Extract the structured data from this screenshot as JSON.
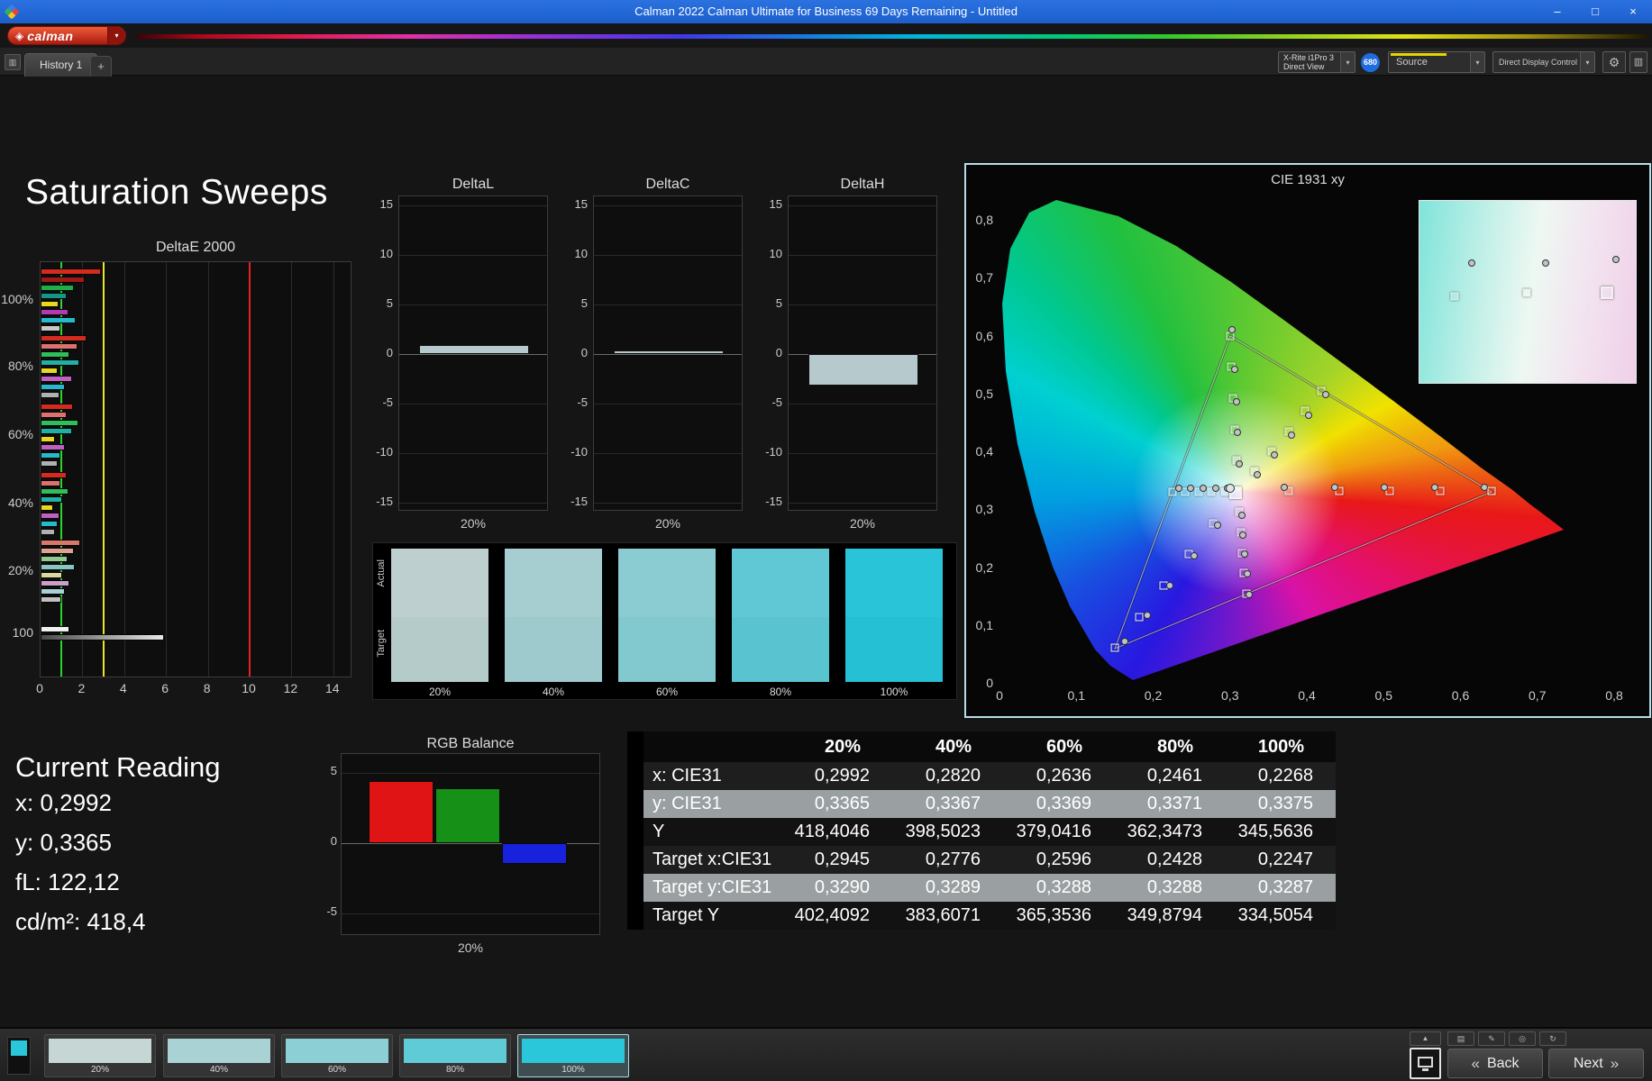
{
  "window": {
    "title": "Calman 2022 Calman Ultimate for Business 69 Days Remaining  - Untitled",
    "minimize": "–",
    "maximize": "□",
    "close": "×"
  },
  "brand": {
    "logo": "calman"
  },
  "tabbar": {
    "history_tab": "History 1",
    "add_tab": "+"
  },
  "toolbar": {
    "meter_line1": "X-Rite i1Pro 3",
    "meter_line2": "Direct View",
    "badge": "680",
    "source": "Source",
    "display_control": "Direct Display Control"
  },
  "icons": {
    "dropdown": "▾",
    "gear": "⚙",
    "menu": "▥",
    "layout": "▥",
    "collapse": "▲",
    "print": "▤",
    "annotate": "✎",
    "preview": "◎",
    "refresh": "↻",
    "back": "«",
    "next": "»",
    "diamond": "◈"
  },
  "page_title": "Saturation Sweeps",
  "deltaE": {
    "title": "DeltaE 2000",
    "x_ticks": [
      "0",
      "2",
      "4",
      "6",
      "8",
      "10",
      "12",
      "14"
    ],
    "ref": {
      "green": 1,
      "yellow": 3,
      "red": 10
    },
    "groups": [
      {
        "label": "100%",
        "bars": [
          {
            "color": "#d42a20",
            "value": 2.9
          },
          {
            "color": "#a01818",
            "value": 2.1
          },
          {
            "color": "#1fae4a",
            "value": 1.6
          },
          {
            "color": "#15958a",
            "value": 1.25
          },
          {
            "color": "#e8d820",
            "value": 0.85
          },
          {
            "color": "#b43ab4",
            "value": 1.35
          },
          {
            "color": "#28b8cc",
            "value": 1.7
          },
          {
            "color": "#c8c8c8",
            "value": 0.95
          }
        ]
      },
      {
        "label": "80%",
        "bars": [
          {
            "color": "#d42a20",
            "value": 2.2
          },
          {
            "color": "#e07070",
            "value": 1.75
          },
          {
            "color": "#2fbe5a",
            "value": 1.4
          },
          {
            "color": "#20b0a4",
            "value": 1.85
          },
          {
            "color": "#e8d820",
            "value": 0.8
          },
          {
            "color": "#c060c0",
            "value": 1.5
          },
          {
            "color": "#28b8cc",
            "value": 1.15
          },
          {
            "color": "#b0b0b0",
            "value": 0.9
          }
        ]
      },
      {
        "label": "60%",
        "bars": [
          {
            "color": "#d42a20",
            "value": 1.55
          },
          {
            "color": "#e07070",
            "value": 1.25
          },
          {
            "color": "#2fbe5a",
            "value": 1.8
          },
          {
            "color": "#20b0a4",
            "value": 1.5
          },
          {
            "color": "#e8d820",
            "value": 0.7
          },
          {
            "color": "#c060c0",
            "value": 1.15
          },
          {
            "color": "#28b8cc",
            "value": 0.95
          },
          {
            "color": "#b0b0b0",
            "value": 0.8
          }
        ]
      },
      {
        "label": "40%",
        "bars": [
          {
            "color": "#d42a20",
            "value": 1.25
          },
          {
            "color": "#e07070",
            "value": 0.95
          },
          {
            "color": "#2fbe5a",
            "value": 1.35
          },
          {
            "color": "#20b0a4",
            "value": 1.05
          },
          {
            "color": "#e8d820",
            "value": 0.6
          },
          {
            "color": "#c060c0",
            "value": 0.9
          },
          {
            "color": "#28b8cc",
            "value": 0.8
          },
          {
            "color": "#b0b0b0",
            "value": 0.7
          }
        ]
      },
      {
        "label": "20%",
        "bars": [
          {
            "color": "#d8786a",
            "value": 1.9
          },
          {
            "color": "#e0a090",
            "value": 1.6
          },
          {
            "color": "#90c890",
            "value": 1.3
          },
          {
            "color": "#88c4c4",
            "value": 1.65
          },
          {
            "color": "#d8d8a0",
            "value": 1.05
          },
          {
            "color": "#c8a0c8",
            "value": 1.4
          },
          {
            "color": "#a8d0d8",
            "value": 1.15
          },
          {
            "color": "#c0c0c0",
            "value": 1.0
          }
        ]
      },
      {
        "label": "100",
        "bars": [
          {
            "color": "#f0f0f0",
            "value": 1.4
          },
          {
            "color": "#bbbbbb",
            "value": 5.9,
            "gradient": true
          }
        ]
      }
    ]
  },
  "deltaL": {
    "title": "DeltaL",
    "x_label": "20%",
    "y_ticks": [
      "15",
      "10",
      "5",
      "0",
      "-5",
      "-10",
      "-15"
    ],
    "value": 0.9
  },
  "deltaC": {
    "title": "DeltaC",
    "x_label": "20%",
    "y_ticks": [
      "15",
      "10",
      "5",
      "0",
      "-5",
      "-10",
      "-15"
    ],
    "value": 0.4
  },
  "deltaH": {
    "title": "DeltaH",
    "x_label": "20%",
    "y_ticks": [
      "15",
      "10",
      "5",
      "0",
      "-5",
      "-10",
      "-15"
    ],
    "value": -3.2
  },
  "swatches": {
    "actual_label": "Actual",
    "target_label": "Target",
    "columns": [
      {
        "label": "20%",
        "actual": "#bdcfce",
        "target": "#b5cbca"
      },
      {
        "label": "40%",
        "actual": "#a6cdd0",
        "target": "#9ec9cd"
      },
      {
        "label": "60%",
        "actual": "#8accd2",
        "target": "#82c8cf"
      },
      {
        "label": "80%",
        "actual": "#60c8d4",
        "target": "#59c4d0"
      },
      {
        "label": "100%",
        "actual": "#2ac4d8",
        "target": "#25c0d4"
      }
    ]
  },
  "cie": {
    "title": "CIE 1931 xy",
    "x_ticks": [
      "0",
      "0,1",
      "0,2",
      "0,3",
      "0,4",
      "0,5",
      "0,6",
      "0,7",
      "0,8"
    ],
    "y_ticks": [
      "0,8",
      "0,7",
      "0,6",
      "0,5",
      "0,4",
      "0,3",
      "0,2",
      "0,1",
      "0"
    ],
    "squares": [
      [
        0.376,
        0.331
      ],
      [
        0.442,
        0.331
      ],
      [
        0.508,
        0.331
      ],
      [
        0.574,
        0.331
      ],
      [
        0.64,
        0.331
      ],
      [
        0.308,
        0.384
      ],
      [
        0.306,
        0.438
      ],
      [
        0.304,
        0.492
      ],
      [
        0.302,
        0.546
      ],
      [
        0.3,
        0.6
      ],
      [
        0.278,
        0.276
      ],
      [
        0.246,
        0.222
      ],
      [
        0.214,
        0.168
      ],
      [
        0.182,
        0.114
      ],
      [
        0.15,
        0.06
      ],
      [
        0.293,
        0.33
      ],
      [
        0.276,
        0.33
      ],
      [
        0.259,
        0.33
      ],
      [
        0.242,
        0.33
      ],
      [
        0.225,
        0.33
      ],
      [
        0.312,
        0.295
      ],
      [
        0.314,
        0.26
      ],
      [
        0.316,
        0.224
      ],
      [
        0.318,
        0.19
      ],
      [
        0.321,
        0.154
      ],
      [
        0.332,
        0.365
      ],
      [
        0.354,
        0.4
      ],
      [
        0.376,
        0.435
      ],
      [
        0.398,
        0.47
      ],
      [
        0.419,
        0.505
      ]
    ],
    "circles": [
      [
        0.371,
        0.337
      ],
      [
        0.436,
        0.337
      ],
      [
        0.501,
        0.338
      ],
      [
        0.566,
        0.338
      ],
      [
        0.631,
        0.338
      ],
      [
        0.312,
        0.378
      ],
      [
        0.31,
        0.432
      ],
      [
        0.308,
        0.486
      ],
      [
        0.306,
        0.542
      ],
      [
        0.303,
        0.61
      ],
      [
        0.284,
        0.272
      ],
      [
        0.253,
        0.22
      ],
      [
        0.222,
        0.168
      ],
      [
        0.192,
        0.116
      ],
      [
        0.163,
        0.072
      ],
      [
        0.297,
        0.336
      ],
      [
        0.281,
        0.336
      ],
      [
        0.265,
        0.336
      ],
      [
        0.249,
        0.336
      ],
      [
        0.233,
        0.336
      ],
      [
        0.315,
        0.29
      ],
      [
        0.317,
        0.256
      ],
      [
        0.319,
        0.222
      ],
      [
        0.322,
        0.188
      ],
      [
        0.325,
        0.152
      ],
      [
        0.336,
        0.36
      ],
      [
        0.358,
        0.394
      ],
      [
        0.38,
        0.428
      ],
      [
        0.402,
        0.462
      ],
      [
        0.425,
        0.498
      ]
    ],
    "current_square": [
      0.307,
      0.329
    ],
    "current_circle": [
      0.3,
      0.336
    ],
    "inset": {
      "squares": [
        [
          0.16,
          0.52
        ],
        [
          0.49,
          0.5
        ]
      ],
      "current_square": [
        0.86,
        0.5
      ],
      "circles": [
        [
          0.24,
          0.34
        ],
        [
          0.58,
          0.34
        ],
        [
          0.9,
          0.32
        ]
      ]
    }
  },
  "reading": {
    "title": "Current Reading",
    "line1": "x: 0,2992",
    "line2": "y: 0,3365",
    "line3": "fL: 122,12",
    "line4": "cd/m²: 418,4"
  },
  "rgb": {
    "title": "RGB Balance",
    "x_label": "20%",
    "y_ticks": [
      "5",
      "0",
      "-5"
    ],
    "bars": [
      {
        "name": "red",
        "color": "#e01414",
        "value": 4.4
      },
      {
        "name": "green",
        "color": "#169016",
        "value": 3.9
      },
      {
        "name": "blue",
        "color": "#1822dc",
        "value": -1.5
      }
    ]
  },
  "table": {
    "columns": [
      "20%",
      "40%",
      "60%",
      "80%",
      "100%"
    ],
    "rows": [
      {
        "label": "x: CIE31",
        "values": [
          "0,2992",
          "0,2820",
          "0,2636",
          "0,2461",
          "0,2268"
        ],
        "highlight": false
      },
      {
        "label": "y: CIE31",
        "values": [
          "0,3365",
          "0,3367",
          "0,3369",
          "0,3371",
          "0,3375"
        ],
        "highlight": true
      },
      {
        "label": "Y",
        "values": [
          "418,4046",
          "398,5023",
          "379,0416",
          "362,3473",
          "345,5636"
        ],
        "highlight": false
      },
      {
        "label": "Target x:CIE31",
        "values": [
          "0,2945",
          "0,2776",
          "0,2596",
          "0,2428",
          "0,2247"
        ],
        "highlight": false
      },
      {
        "label": "Target y:CIE31",
        "values": [
          "0,3290",
          "0,3289",
          "0,3288",
          "0,3288",
          "0,3287"
        ],
        "highlight": true
      },
      {
        "label": "Target Y",
        "values": [
          "402,4092",
          "383,6071",
          "365,3536",
          "349,8794",
          "334,5054"
        ],
        "highlight": false
      }
    ]
  },
  "filmstrip": [
    {
      "label": "20%",
      "color": "#c5d6d4"
    },
    {
      "label": "40%",
      "color": "#a9d2d4"
    },
    {
      "label": "60%",
      "color": "#8cd0d6"
    },
    {
      "label": "80%",
      "color": "#5ecbd6"
    },
    {
      "label": "100%",
      "color": "#2ac6da",
      "selected": true
    }
  ],
  "nav": {
    "back": "Back",
    "next": "Next"
  }
}
